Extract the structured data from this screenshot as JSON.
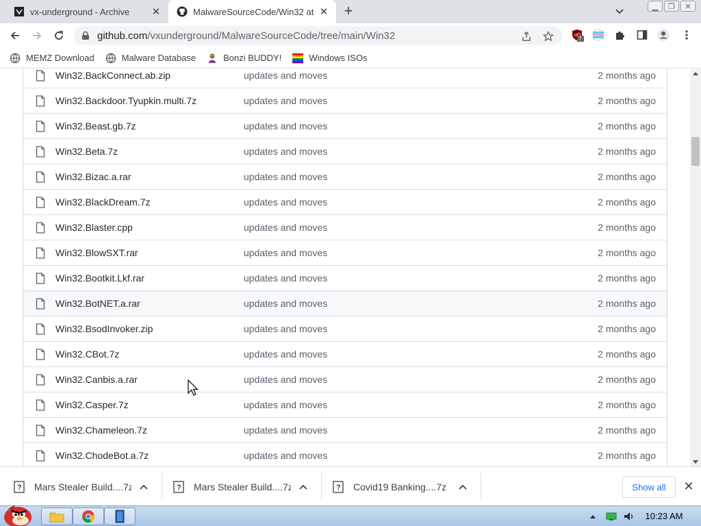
{
  "tabs": [
    {
      "title": "vx-underground - Archive",
      "active": false
    },
    {
      "title": "MalwareSourceCode/Win32 at",
      "active": true
    }
  ],
  "address_bar": {
    "host": "github.com",
    "path": "/vxunderground/MalwareSourceCode/tree/main/Win32"
  },
  "extensions": {
    "badge_count": "7"
  },
  "bookmarks": [
    {
      "label": "MEMZ Download",
      "icon": "globe-icon"
    },
    {
      "label": "Malware Database",
      "icon": "globe-icon"
    },
    {
      "label": "Bonzi BUDDY!",
      "icon": "bonzi-icon"
    },
    {
      "label": "Windows ISOs",
      "icon": "rainbow-flag-icon"
    }
  ],
  "files": [
    {
      "name": "Win32.BackConnect.ab.zip",
      "message": "updates and moves",
      "age": "2 months ago"
    },
    {
      "name": "Win32.Backdoor.Tyupkin.multi.7z",
      "message": "updates and moves",
      "age": "2 months ago"
    },
    {
      "name": "Win32.Beast.gb.7z",
      "message": "updates and moves",
      "age": "2 months ago"
    },
    {
      "name": "Win32.Beta.7z",
      "message": "updates and moves",
      "age": "2 months ago"
    },
    {
      "name": "Win32.Bizac.a.rar",
      "message": "updates and moves",
      "age": "2 months ago"
    },
    {
      "name": "Win32.BlackDream.7z",
      "message": "updates and moves",
      "age": "2 months ago"
    },
    {
      "name": "Win32.Blaster.cpp",
      "message": "updates and moves",
      "age": "2 months ago"
    },
    {
      "name": "Win32.BlowSXT.rar",
      "message": "updates and moves",
      "age": "2 months ago"
    },
    {
      "name": "Win32.Bootkit.Lkf.rar",
      "message": "updates and moves",
      "age": "2 months ago"
    },
    {
      "name": "Win32.BotNET.a.rar",
      "message": "updates and moves",
      "age": "2 months ago",
      "hover": true
    },
    {
      "name": "Win32.BsodInvoker.zip",
      "message": "updates and moves",
      "age": "2 months ago"
    },
    {
      "name": "Win32.CBot.7z",
      "message": "updates and moves",
      "age": "2 months ago"
    },
    {
      "name": "Win32.Canbis.a.rar",
      "message": "updates and moves",
      "age": "2 months ago"
    },
    {
      "name": "Win32.Casper.7z",
      "message": "updates and moves",
      "age": "2 months ago"
    },
    {
      "name": "Win32.Chameleon.7z",
      "message": "updates and moves",
      "age": "2 months ago"
    },
    {
      "name": "Win32.ChodeBot.a.7z",
      "message": "updates and moves",
      "age": "2 months ago"
    }
  ],
  "downloads": [
    {
      "name": "Mars Stealer Build....7z"
    },
    {
      "name": "Mars Stealer Build....7z"
    },
    {
      "name": "Covid19 Banking....7z"
    }
  ],
  "download_shelf": {
    "show_all_label": "Show all"
  },
  "taskbar": {
    "clock": "10:23 AM"
  },
  "colors": {
    "link_blue": "#1a73e8",
    "tab_strip": "#dee1e6",
    "row_border": "#d8dee4"
  }
}
